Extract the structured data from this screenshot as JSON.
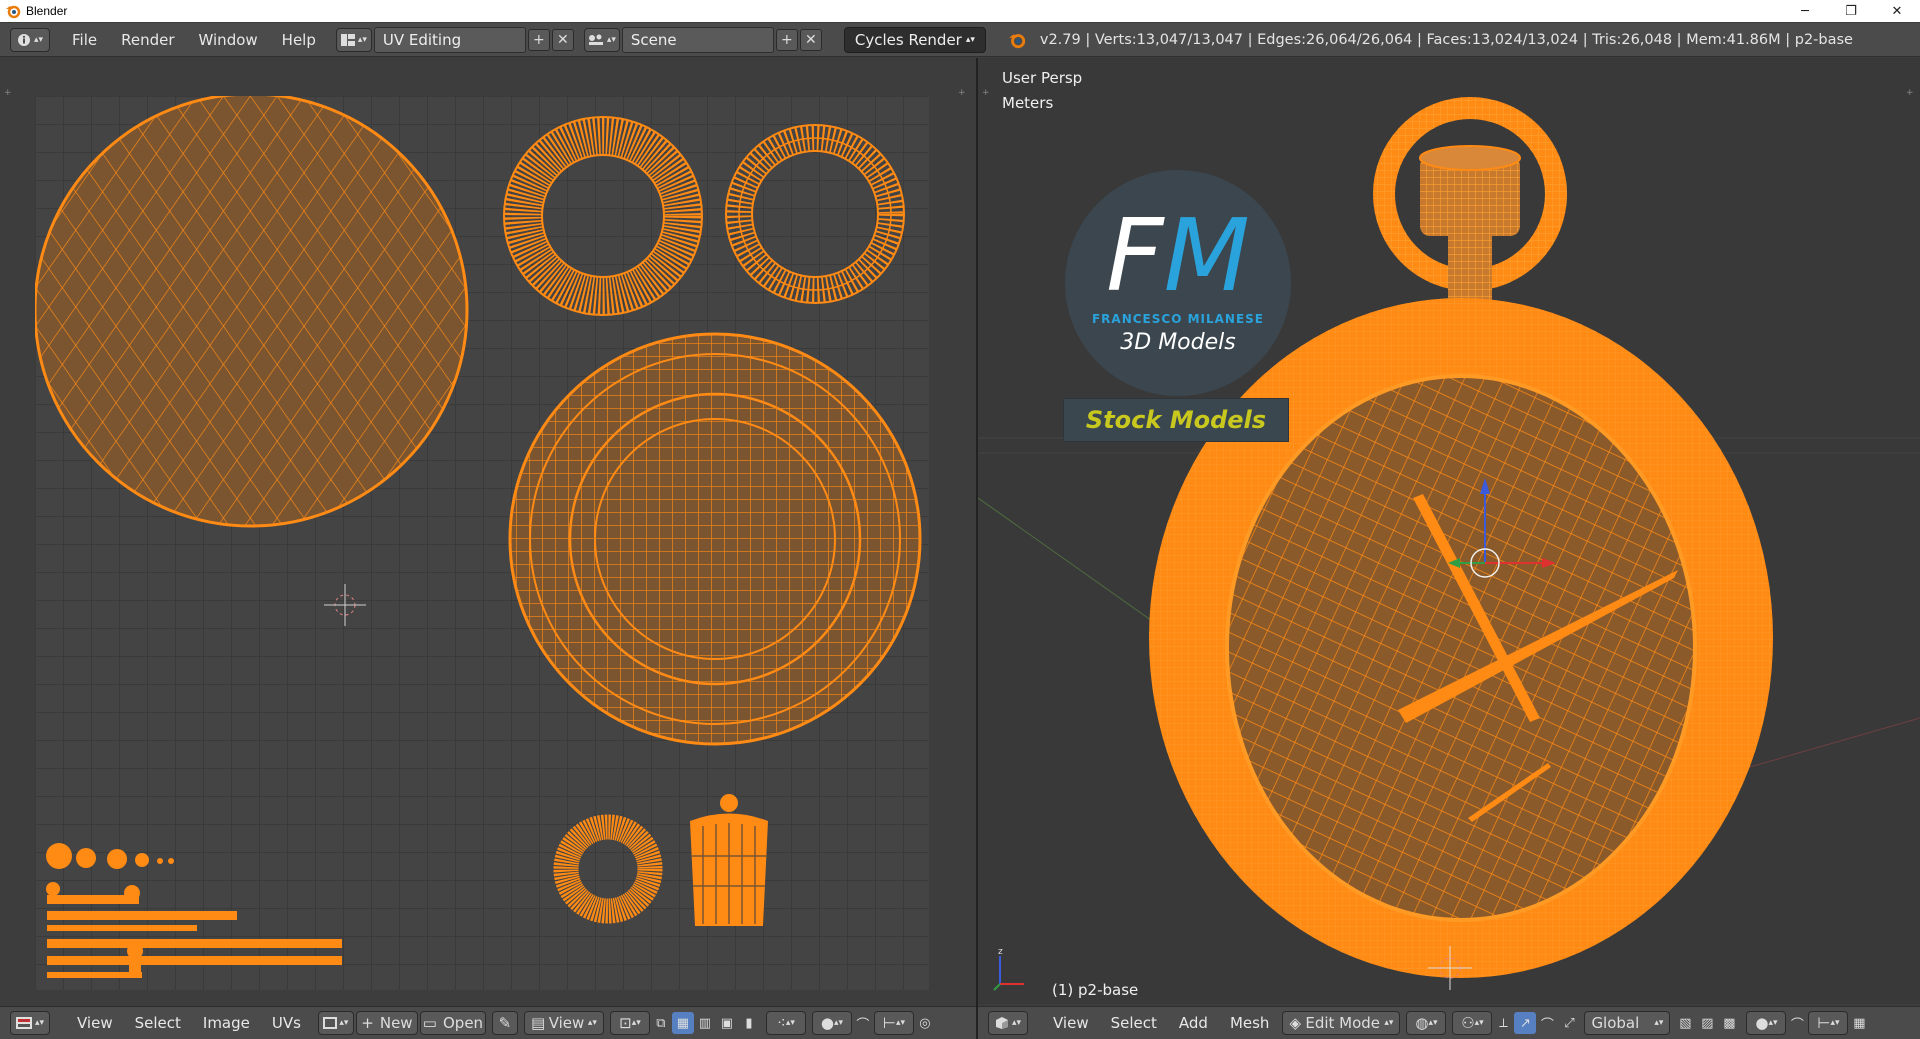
{
  "titlebar": {
    "title": "Blender",
    "minimize": "─",
    "restore": "❐",
    "close": "✕"
  },
  "infobar": {
    "info_icon": "info-icon",
    "menus": [
      "File",
      "Render",
      "Window",
      "Help"
    ],
    "screen_layout": "UV Editing",
    "scene": "Scene",
    "render_engine": "Cycles Render",
    "stats": "v2.79 | Verts:13,047/13,047 | Edges:26,064/26,064 | Faces:13,024/13,024 | Tris:26,048 | Mem:41.86M | p2-base"
  },
  "uv_editor": {
    "menus": [
      "View",
      "Select",
      "Image",
      "UVs"
    ],
    "new_label": "New",
    "open_label": "Open",
    "view_label": "View"
  },
  "viewport": {
    "view_name": "User Persp",
    "units": "Meters",
    "object_label": "(1) p2-base",
    "logo_initials_f": "F",
    "logo_initials_m": "M",
    "logo_name": "FRANCESCO MILANESE",
    "logo_sub": "3D Models",
    "logo_banner": "Stock Models",
    "menus": [
      "View",
      "Select",
      "Add",
      "Mesh"
    ],
    "mode": "Edit Mode",
    "orientation": "Global"
  },
  "colors": {
    "accent_orange": "#ff8a14",
    "header_bg": "#4b4b4b",
    "logo_blue": "#2aa3dc",
    "logo_yellow": "#c8c81e"
  }
}
